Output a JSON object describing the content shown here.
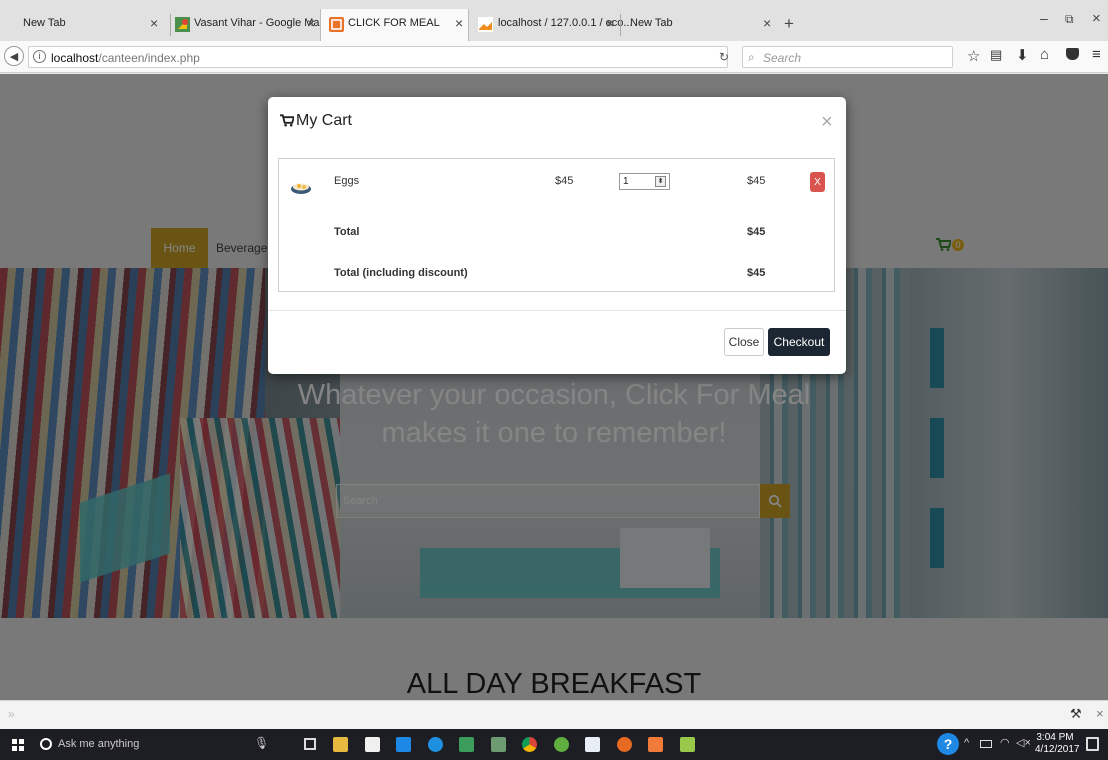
{
  "browser": {
    "tabs": [
      {
        "title": "New Tab"
      },
      {
        "title": "Vasant Vihar - Google Maps"
      },
      {
        "title": "CLICK FOR MEAL"
      },
      {
        "title": "localhost / 127.0.0.1 / eco..."
      },
      {
        "title": "New Tab"
      }
    ],
    "url_host": "localhost",
    "url_path": "/canteen/index.php",
    "search_placeholder": "Search"
  },
  "site": {
    "nav": [
      {
        "label": "Home"
      },
      {
        "label": "Beverage"
      }
    ],
    "cart_count": "0",
    "hero_line1": "Whatever your occasion, Click For Meal",
    "hero_line2": "makes it one to remember!",
    "search_placeholder": "Search",
    "section_title": "ALL DAY BREAKFAST"
  },
  "modal": {
    "title": "My Cart",
    "items": [
      {
        "name": "Eggs",
        "price": "$45",
        "qty": "1",
        "subtotal": "$45",
        "remove_label": "X"
      }
    ],
    "total_label": "Total",
    "total_value": "$45",
    "discount_label": "Total (including discount)",
    "discount_value": "$45",
    "close_label": "Close",
    "checkout_label": "Checkout",
    "dismiss_glyph": "×"
  },
  "taskbar": {
    "search_placeholder": "Ask me anything",
    "time": "3:04 PM",
    "date": "4/12/2017"
  },
  "colors": {
    "accent_gold": "#c9a227",
    "btn_danger": "#d9534f",
    "btn_dark": "#1c2633",
    "cart_green": "#3a8d2f"
  }
}
